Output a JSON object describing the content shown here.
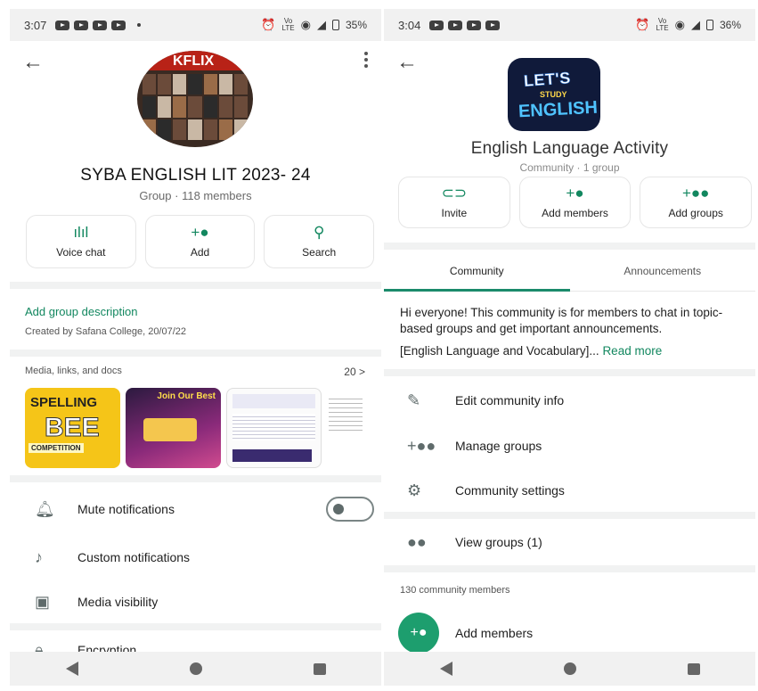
{
  "left": {
    "status": {
      "time": "3:07",
      "battery": "35%"
    },
    "group": {
      "name": "SYBA ENGLISH LIT 2023- 24",
      "meta": "Group · 118 members",
      "photo_text": "KFLIX"
    },
    "actions": [
      {
        "label": "Voice chat",
        "icon": "voice-chat-icon"
      },
      {
        "label": "Add",
        "icon": "add-person-icon"
      },
      {
        "label": "Search",
        "icon": "search-icon"
      }
    ],
    "description_link": "Add group description",
    "created": "Created by Safana College, 20/07/22",
    "media": {
      "title": "Media, links, and docs",
      "count": "20 >",
      "thumb1_title": "SPELLING",
      "thumb1_big": "BEE",
      "thumb1_sub": "COMPETITION",
      "thumb2_title": "Join Our Best"
    },
    "rows": [
      {
        "label": "Mute notifications",
        "icon": "bell-icon"
      },
      {
        "label": "Custom notifications",
        "icon": "music-note-icon"
      },
      {
        "label": "Media visibility",
        "icon": "image-icon"
      },
      {
        "label": "Encryption",
        "icon": "lock-icon"
      }
    ]
  },
  "right": {
    "status": {
      "time": "3:04",
      "battery": "36%"
    },
    "community": {
      "name": "English Language Activity",
      "meta": "Community · 1 group",
      "logo_line1": "LET'S",
      "logo_line2": "STUDY",
      "logo_line3": "ENGLISH"
    },
    "actions": [
      {
        "label": "Invite",
        "icon": "link-icon"
      },
      {
        "label": "Add members",
        "icon": "add-person-icon"
      },
      {
        "label": "Add groups",
        "icon": "add-group-icon"
      }
    ],
    "tabs": [
      "Community",
      "Announcements"
    ],
    "about": "Hi everyone! This community is for members to chat in topic-based groups and get important announcements.",
    "about_line2": "[English Language and Vocabulary]...",
    "read_more": "Read more",
    "rows": [
      {
        "label": "Edit community info",
        "icon": "pencil-icon"
      },
      {
        "label": "Manage groups",
        "icon": "manage-groups-icon"
      },
      {
        "label": "Community settings",
        "icon": "gear-icon"
      },
      {
        "label": "View groups (1)",
        "icon": "groups-icon"
      }
    ],
    "members_count": "130 community members",
    "add_members": "Add members"
  },
  "colors": {
    "accent": "#12875f",
    "accent_circle": "#1d9e6e",
    "tab_indicator": "#1b8a6b"
  }
}
